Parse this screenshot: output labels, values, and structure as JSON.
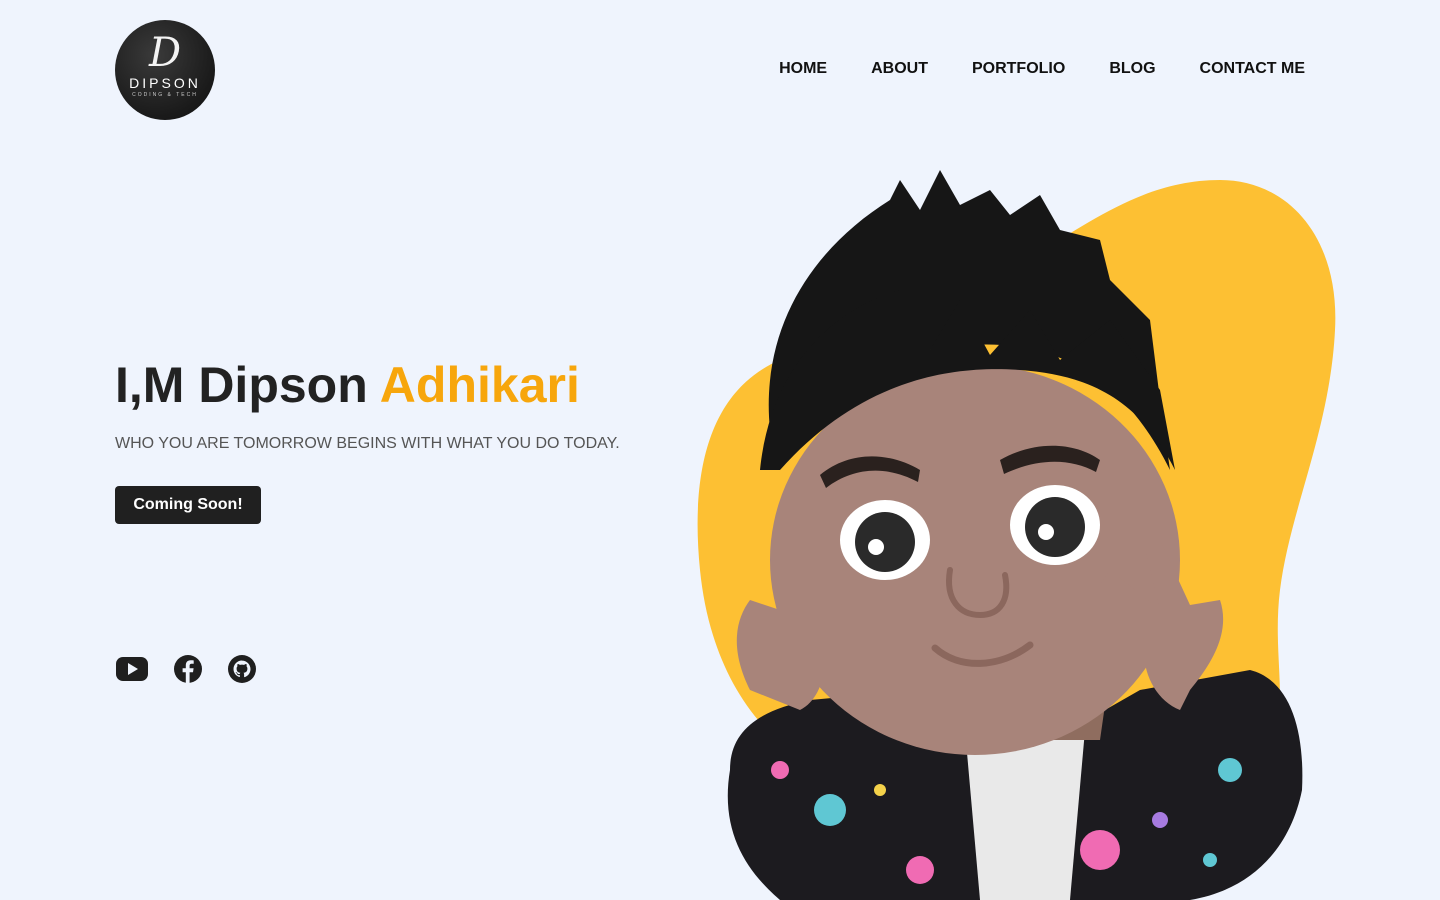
{
  "header": {
    "logo": {
      "mark": "D",
      "name": "DIPSON",
      "tagline": "CODING & TECH"
    },
    "nav": [
      {
        "label": "HOME"
      },
      {
        "label": "ABOUT"
      },
      {
        "label": "PORTFOLIO"
      },
      {
        "label": "BLOG"
      },
      {
        "label": "CONTACT ME"
      }
    ]
  },
  "hero": {
    "title_main": "I,M Dipson ",
    "title_accent": "Adhikari",
    "subtitle": "WHO YOU ARE TOMORROW BEGINS WITH WHAT YOU DO TODAY.",
    "cta_label": "Coming Soon!"
  },
  "socials": [
    {
      "icon": "youtube-icon"
    },
    {
      "icon": "facebook-icon"
    },
    {
      "icon": "github-icon"
    }
  ],
  "colors": {
    "background": "#eff4fd",
    "accent": "#f7a60c",
    "blob": "#fdc033",
    "button": "#202020",
    "text": "#222222"
  }
}
